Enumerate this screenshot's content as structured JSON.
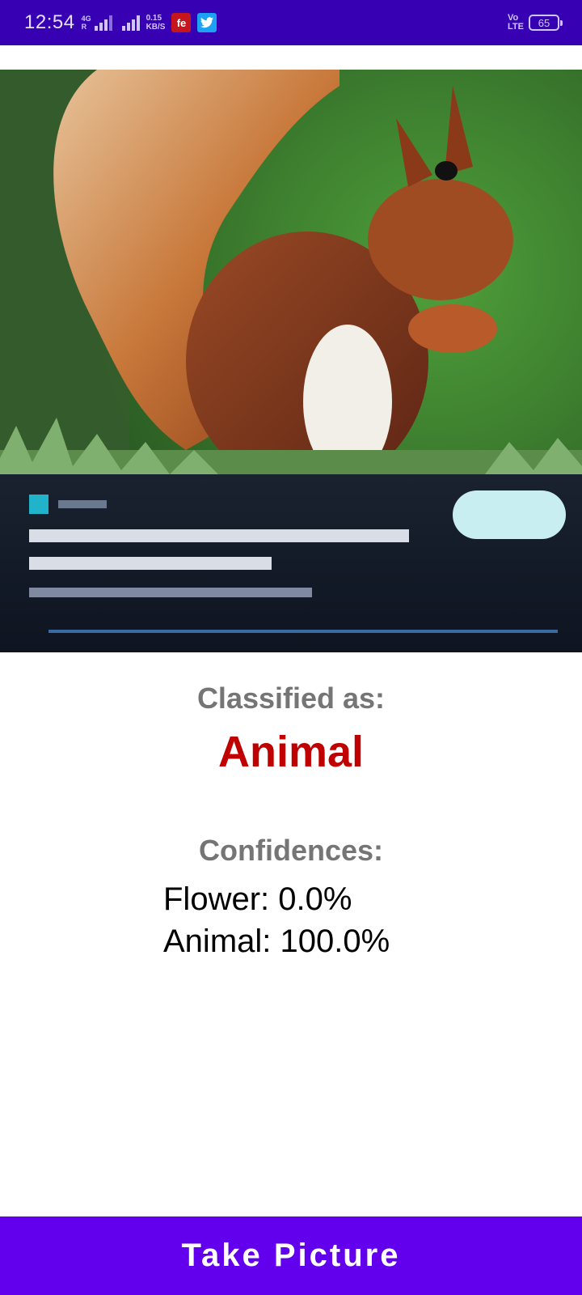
{
  "status_bar": {
    "time": "12:54",
    "network_top": "4G",
    "network_bottom": "R",
    "speed_value": "0.15",
    "speed_unit": "KB/S",
    "app_icon_1": "fe",
    "app_icon_1_color": "#c4161c",
    "app_icon_2_name": "twitter-icon",
    "app_icon_2_color": "#1da1f2",
    "volte_top": "Vo",
    "volte_bottom": "LTE",
    "battery": "65"
  },
  "photo": {
    "icon": "squirrel-photo"
  },
  "result": {
    "classified_label": "Classified as:",
    "classified_value": "Animal",
    "classified_color": "#c00000",
    "confidences_label": "Confidences:",
    "confidences": [
      {
        "text": "Flower: 0.0%"
      },
      {
        "text": "Animal: 100.0%"
      }
    ]
  },
  "button": {
    "label": "Take Picture",
    "color": "#6200ee"
  }
}
